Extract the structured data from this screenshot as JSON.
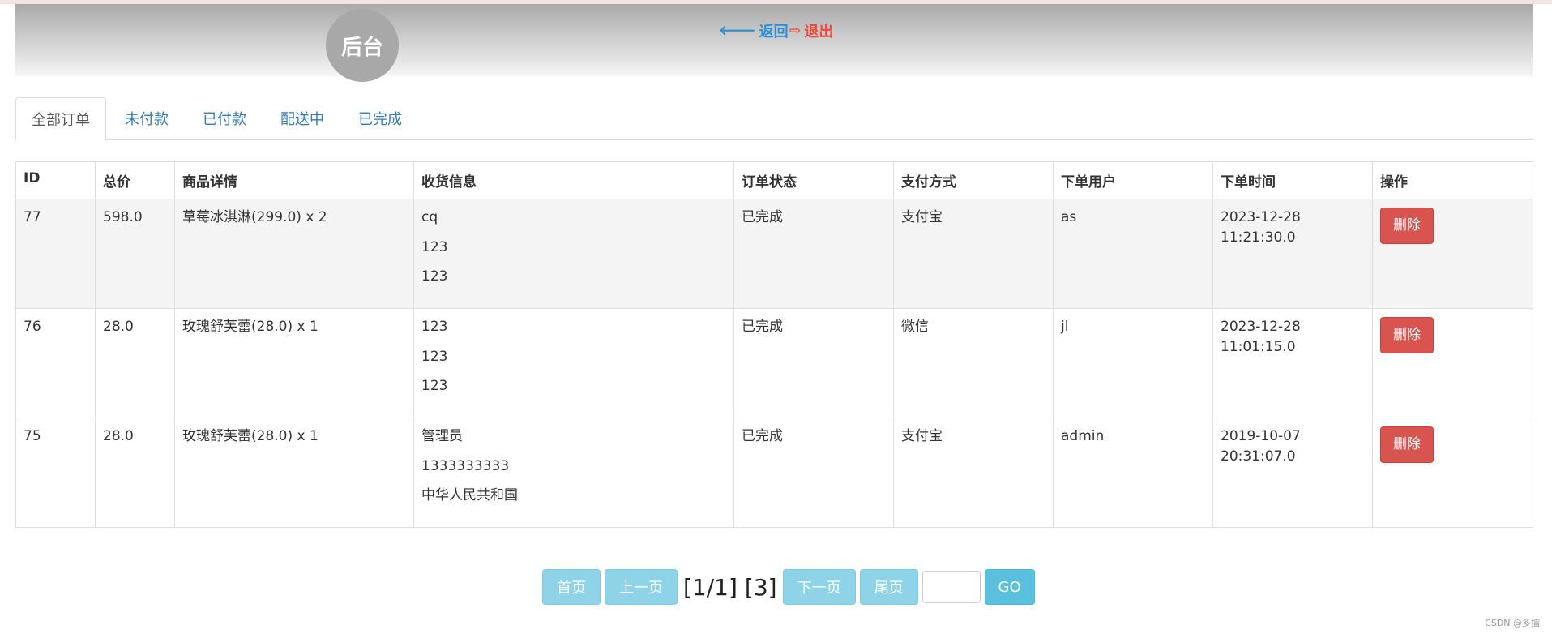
{
  "header": {
    "logo": "后台",
    "back_label": "返回",
    "logout_label": "退出"
  },
  "tabs": [
    {
      "label": "全部订单",
      "active": true
    },
    {
      "label": "未付款",
      "active": false
    },
    {
      "label": "已付款",
      "active": false
    },
    {
      "label": "配送中",
      "active": false
    },
    {
      "label": "已完成",
      "active": false
    }
  ],
  "table": {
    "columns": [
      "ID",
      "总价",
      "商品详情",
      "收货信息",
      "订单状态",
      "支付方式",
      "下单用户",
      "下单时间",
      "操作"
    ],
    "rows": [
      {
        "id": "77",
        "total": "598.0",
        "items": "草莓冰淇淋(299.0) x 2",
        "address": [
          "cq",
          "123",
          "123"
        ],
        "status": "已完成",
        "payment": "支付宝",
        "user": "as",
        "time": [
          "2023-12-28",
          "11:21:30.0"
        ],
        "action": "删除"
      },
      {
        "id": "76",
        "total": "28.0",
        "items": "玫瑰舒芙蕾(28.0) x 1",
        "address": [
          "123",
          "123",
          "123"
        ],
        "status": "已完成",
        "payment": "微信",
        "user": "jl",
        "time": [
          "2023-12-28",
          "11:01:15.0"
        ],
        "action": "删除"
      },
      {
        "id": "75",
        "total": "28.0",
        "items": "玫瑰舒芙蕾(28.0) x 1",
        "address": [
          "管理员",
          "1333333333",
          "中华人民共和国"
        ],
        "status": "已完成",
        "payment": "支付宝",
        "user": "admin",
        "time": [
          "2019-10-07",
          "20:31:07.0"
        ],
        "action": "删除"
      }
    ]
  },
  "pager": {
    "first": "首页",
    "prev": "上一页",
    "page_info": "[1/1]",
    "total_info": "[3]",
    "next": "下一页",
    "last": "尾页",
    "go": "GO",
    "input_value": ""
  },
  "watermark": "CSDN @多擂",
  "colors": {
    "header_gradient_top": "#a9a9a9",
    "back_link": "#2a8fd6",
    "logout_link": "#e74c3c",
    "delete_button": "#d9534f",
    "pager_button": "#8fd3e8",
    "go_button": "#5bc0de"
  }
}
